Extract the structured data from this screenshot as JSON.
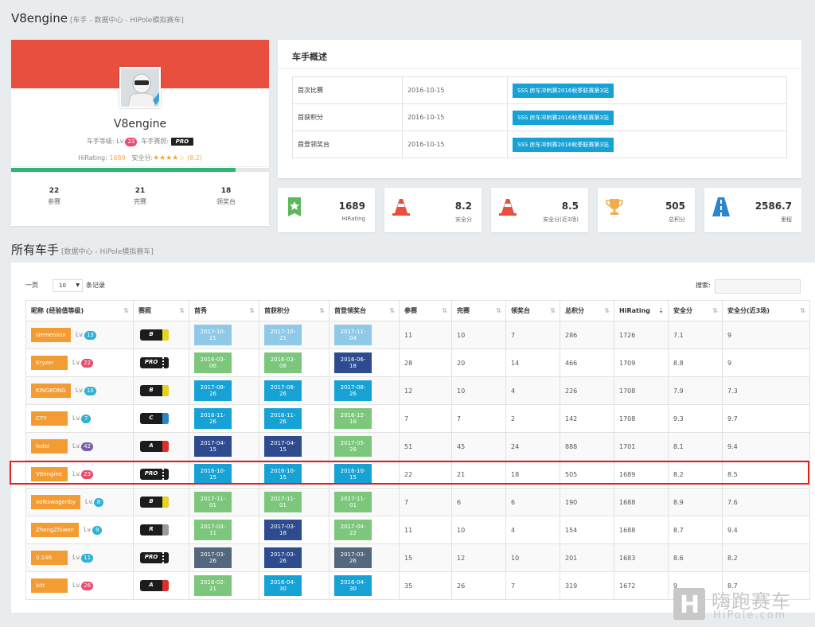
{
  "page": {
    "title": "V8engine",
    "subtitle": "[车手 - 数据中心 - HiPole模拟赛车]"
  },
  "profile": {
    "name": "V8engine",
    "level_label": "车手等级:",
    "level_prefix": "Lv.",
    "level": "23",
    "license_label": "车手赛照:",
    "license": "PRO",
    "hirating_label": "HiRating:",
    "hirating": "1689",
    "safety_label": "安全分:",
    "stars": "★★★★☆",
    "safety_score": "(8.2)",
    "progress_fraction": 0.87,
    "stats": [
      {
        "value": "22",
        "label": "参赛"
      },
      {
        "value": "21",
        "label": "完赛"
      },
      {
        "value": "18",
        "label": "领奖台"
      }
    ]
  },
  "overview": {
    "title": "车手概述",
    "rows": [
      {
        "key": "首次比赛",
        "date": "2016-10-15",
        "event": "SSS 房车冲刺赛2016秋季联赛第3站"
      },
      {
        "key": "首获积分",
        "date": "2016-10-15",
        "event": "SSS 房车冲刺赛2016秋季联赛第3站"
      },
      {
        "key": "首登领奖台",
        "date": "2016-10-15",
        "event": "SSS 房车冲刺赛2016秋季联赛第3站"
      }
    ]
  },
  "stat_boxes": [
    {
      "icon": "ribbon-icon",
      "value": "1689",
      "label": "HiRating"
    },
    {
      "icon": "traffic-cone-icon",
      "value": "8.2",
      "label": "安全分"
    },
    {
      "icon": "traffic-cone-icon",
      "value": "8.5",
      "label": "安全分(近3场)"
    },
    {
      "icon": "trophy-icon",
      "value": "505",
      "label": "总积分"
    },
    {
      "icon": "road-icon",
      "value": "2586.7",
      "label": "里程"
    }
  ],
  "drivers_section": {
    "title": "所有车手",
    "subtitle": "[数据中心 - HiPole模拟赛车]"
  },
  "table_controls": {
    "length_before": "一页",
    "length_value": "10",
    "length_after": "条记录",
    "search_label": "搜索:",
    "search_value": ""
  },
  "table": {
    "headers": [
      "昵称 (经验值等级)",
      "赛照",
      "首秀",
      "首获积分",
      "首登领奖台",
      "参赛",
      "完赛",
      "领奖台",
      "总积分",
      "HiRating",
      "安全分",
      "安全分(近3场)"
    ],
    "rows": [
      {
        "name": "siemenson",
        "lv": "13",
        "lv_color": "#31b0d5",
        "license": "B",
        "license_stripe": "#e8d21d",
        "debut": "2017-10-21",
        "debut_color": "#8fc9e8",
        "points": "2017-10-21",
        "points_color": "#8fc9e8",
        "podium": "2017-11-04",
        "podium_color": "#8fc9e8",
        "starts": "11",
        "finishes": "10",
        "podiums": "7",
        "total": "286",
        "rating": "1726",
        "safety": "7.1",
        "safety3": "9"
      },
      {
        "name": "Kryzer",
        "lv": "22",
        "lv_color": "#e84c6f",
        "license": "PRO",
        "license_stripe": "#1c1c1c",
        "debut": "2016-03-06",
        "debut_color": "#7cc77c",
        "points": "2016-03-06",
        "points_color": "#7cc77c",
        "podium": "2016-06-18",
        "podium_color": "#2d4b8e",
        "starts": "28",
        "finishes": "20",
        "podiums": "14",
        "total": "466",
        "rating": "1709",
        "safety": "8.8",
        "safety3": "9"
      },
      {
        "name": "KINGKONG",
        "lv": "10",
        "lv_color": "#31b0d5",
        "license": "B",
        "license_stripe": "#e8d21d",
        "debut": "2017-08-26",
        "debut_color": "#17a2d6",
        "points": "2017-08-26",
        "points_color": "#17a2d6",
        "podium": "2017-08-26",
        "podium_color": "#17a2d6",
        "starts": "12",
        "finishes": "10",
        "podiums": "4",
        "total": "226",
        "rating": "1708",
        "safety": "7.9",
        "safety3": "7.3"
      },
      {
        "name": "CTY",
        "lv": "7",
        "lv_color": "#31b0d5",
        "license": "C",
        "license_stripe": "#2a86c9",
        "debut": "2016-11-26",
        "debut_color": "#17a2d6",
        "points": "2016-11-26",
        "points_color": "#17a2d6",
        "podium": "2016-12-18",
        "podium_color": "#7cc77c",
        "starts": "7",
        "finishes": "7",
        "podiums": "2",
        "total": "142",
        "rating": "1708",
        "safety": "9.3",
        "safety3": "9.7"
      },
      {
        "name": "ledel",
        "lv": "42",
        "lv_color": "#7d5ca8",
        "license": "A",
        "license_stripe": "#e02d2d",
        "debut": "2017-04-15",
        "debut_color": "#2d4b8e",
        "points": "2017-04-15",
        "points_color": "#2d4b8e",
        "podium": "2017-05-28",
        "podium_color": "#7cc77c",
        "starts": "51",
        "finishes": "45",
        "podiums": "24",
        "total": "888",
        "rating": "1701",
        "safety": "8.1",
        "safety3": "9.4"
      },
      {
        "name": "V8engine",
        "lv": "23",
        "lv_color": "#e84c6f",
        "license": "PRO",
        "license_stripe": "#1c1c1c",
        "debut": "2016-10-15",
        "debut_color": "#17a2d6",
        "points": "2016-10-15",
        "points_color": "#17a2d6",
        "podium": "2016-10-15",
        "podium_color": "#17a2d6",
        "starts": "22",
        "finishes": "21",
        "podiums": "18",
        "total": "505",
        "rating": "1689",
        "safety": "8.2",
        "safety3": "8.5"
      },
      {
        "name": "volkswagenby",
        "lv": "8",
        "lv_color": "#31b0d5",
        "license": "B",
        "license_stripe": "#e8d21d",
        "debut": "2017-11-01",
        "debut_color": "#7cc77c",
        "points": "2017-11-01",
        "points_color": "#7cc77c",
        "podium": "2017-11-01",
        "podium_color": "#7cc77c",
        "starts": "7",
        "finishes": "6",
        "podiums": "6",
        "total": "190",
        "rating": "1688",
        "safety": "8.9",
        "safety3": "7.6"
      },
      {
        "name": "ZhengZhiwen",
        "lv": "9",
        "lv_color": "#31b0d5",
        "license": "R",
        "license_stripe": "#9a9a9a",
        "debut": "2017-03-11",
        "debut_color": "#7cc77c",
        "points": "2017-03-18",
        "points_color": "#2d4b8e",
        "podium": "2017-04-22",
        "podium_color": "#7cc77c",
        "starts": "11",
        "finishes": "10",
        "podiums": "4",
        "total": "154",
        "rating": "1688",
        "safety": "8.7",
        "safety3": "9.4"
      },
      {
        "name": "0.146",
        "lv": "11",
        "lv_color": "#31b0d5",
        "license": "PRO",
        "license_stripe": "#1c1c1c",
        "debut": "2017-03-26",
        "debut_color": "#53677e",
        "points": "2017-03-26",
        "points_color": "#2d4b8e",
        "podium": "2017-03-26",
        "podium_color": "#53677e",
        "starts": "15",
        "finishes": "12",
        "podiums": "10",
        "total": "201",
        "rating": "1683",
        "safety": "8.6",
        "safety3": "8.2"
      },
      {
        "name": "kitt",
        "lv": "26",
        "lv_color": "#e84c6f",
        "license": "A",
        "license_stripe": "#e02d2d",
        "debut": "2016-02-21",
        "debut_color": "#7cc77c",
        "points": "2016-04-30",
        "points_color": "#17a2d6",
        "podium": "2016-04-30",
        "podium_color": "#17a2d6",
        "starts": "35",
        "finishes": "26",
        "podiums": "7",
        "total": "319",
        "rating": "1672",
        "safety": "9",
        "safety3": "8.7"
      }
    ]
  },
  "watermark": {
    "cn": "嗨跑赛车",
    "en": "HiPole.com",
    "logo": "H"
  }
}
